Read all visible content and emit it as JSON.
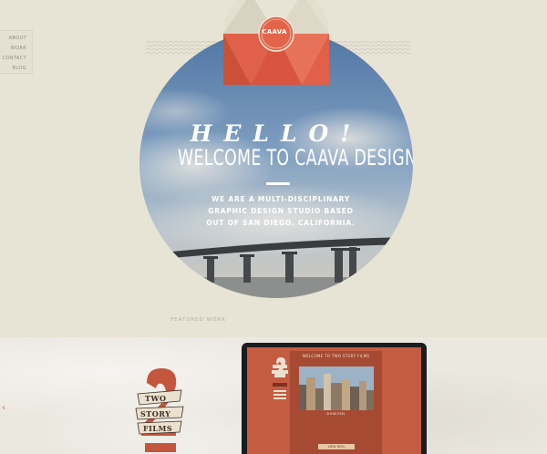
{
  "nav": {
    "items": [
      {
        "label": "ABOUT"
      },
      {
        "label": "WORK"
      },
      {
        "label": "CONTACT"
      },
      {
        "label": "BLOG"
      }
    ]
  },
  "logo": {
    "text": "CAAVA"
  },
  "hero": {
    "hello": "HELLO!",
    "welcome": "WELCOME TO CAAVA DESIGN",
    "tagline": "WE ARE A MULTI-DISCIPLINARY GRAPHIC DESIGN STUDIO BASED OUT OF SAN DIEGO, CALIFORNIA."
  },
  "featured": {
    "label": "FEATURED WORK",
    "prev_arrow": "‹",
    "project_logo": {
      "line1": "TWO",
      "line2": "STORY",
      "line3": "FILMS"
    },
    "screen": {
      "title": "WELCOME TO TWO STORY FILMS",
      "caption": "SHOW REEL",
      "cta": "VIEW REEL"
    }
  },
  "colors": {
    "background": "#e8e4d5",
    "accent": "#e2654b",
    "sky": "#6d8fb4",
    "text_light": "#ffffff"
  }
}
